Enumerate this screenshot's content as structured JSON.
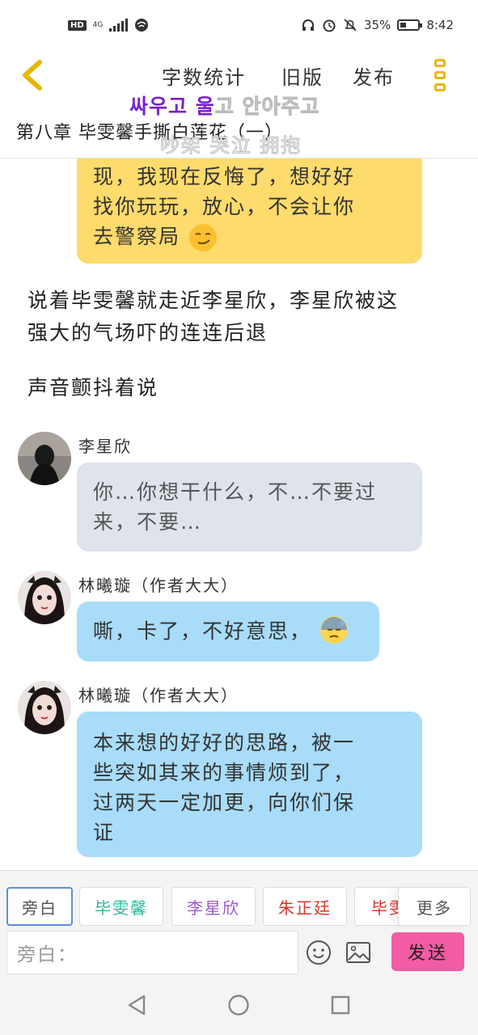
{
  "status_bar": {
    "hd": "HD",
    "network": "4G",
    "battery_text": "35%",
    "battery_level": 0.35,
    "time": "8:42"
  },
  "header": {
    "links": [
      "字数统计",
      "旧版",
      "发布"
    ],
    "back_icon": "chevron-left-icon",
    "menu_icon": "vertical-dots-icon",
    "accent_color": "#e6b800"
  },
  "overlay": {
    "korean_colored": "싸우고 울",
    "korean_ghost": "고 안아주고",
    "chinese_ghost": "吵架 哭泣 拥抱"
  },
  "chapter_title": "第八章 毕雯馨手撕白莲花（一）",
  "messages": {
    "top_bubble": {
      "lines": [
        "现，我现在反悔了，想好好",
        "找你玩玩，放心，不会让你"
      ],
      "last_line": "去警察局",
      "emoji": "smirk-emoji",
      "color": "#fddb6c"
    },
    "narration_1": [
      "说着毕雯馨就走近李星欣，李星欣被这",
      "强大的气场吓的连连后退"
    ],
    "narration_2": "声音颤抖着说",
    "msg_1": {
      "speaker": "李星欣",
      "lines": [
        "你…你想干什么，不…不要过",
        "来，不要…"
      ],
      "color": "#dfe3ec"
    },
    "msg_2": {
      "speaker": "林曦璇（作者大大）",
      "text": "嘶，卡了，不好意思，",
      "emoji": "sweat-emoji",
      "color": "#a8dcf8"
    },
    "msg_3": {
      "speaker": "林曦璇（作者大大）",
      "lines": [
        "本来想的好好的思路，被一",
        "些突如其来的事情烦到了，",
        "过两天一定加更，向你们保",
        "证"
      ],
      "color": "#a8dcf8"
    }
  },
  "composer": {
    "roles": [
      {
        "label": "旁白",
        "color": "#555555"
      },
      {
        "label": "毕雯馨",
        "color": "#2bb59a"
      },
      {
        "label": "李星欣",
        "color": "#9b59d0"
      },
      {
        "label": "朱正廷",
        "color": "#d9342b"
      },
      {
        "label": "毕雯",
        "color": "#d9342b"
      }
    ],
    "more": "更多",
    "input_placeholder": "旁白：",
    "send": "发送",
    "send_color": "#f25ca4"
  },
  "nav": {
    "back": "back-triangle-icon",
    "home": "home-circle-icon",
    "recents": "recents-square-icon"
  }
}
